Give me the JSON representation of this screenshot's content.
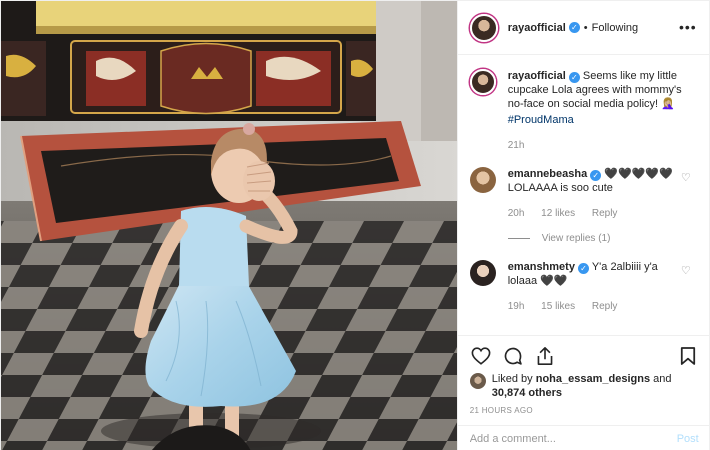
{
  "post": {
    "author": "rayaofficial",
    "following_label": "Following",
    "dot": "•",
    "more_icon": "more-icon",
    "caption": {
      "username": "rayaofficial",
      "text": "Seems like my little cupcake Lola agrees with mommy's no-face on social media policy! 🤦🏼‍♀️",
      "hashtag": "#ProudMama",
      "time": "21h"
    },
    "comments": [
      {
        "username": "emannebeasha",
        "text": "🖤🖤🖤🖤🖤",
        "text2": "LOLAAAA is soo cute",
        "time": "20h",
        "likes": "12 likes",
        "reply": "Reply",
        "view_replies": "View replies (1)"
      },
      {
        "username": "emanshmety",
        "text": "Y'a 2albiiii y'a lolaaa 🖤🖤",
        "time": "19h",
        "likes": "15 likes",
        "reply": "Reply"
      }
    ],
    "likes_text_prefix": "Liked by ",
    "likes_user": "noha_essam_designs",
    "likes_and": " and",
    "likes_count": "30,874 others",
    "timestamp": "21 HOURS AGO",
    "add_comment_placeholder": "Add a comment...",
    "post_button": "Post",
    "colors": {
      "verified": "#3897f0",
      "link": "#003569",
      "muted": "#8e8e8e",
      "post_button": "#b2dffc"
    }
  }
}
